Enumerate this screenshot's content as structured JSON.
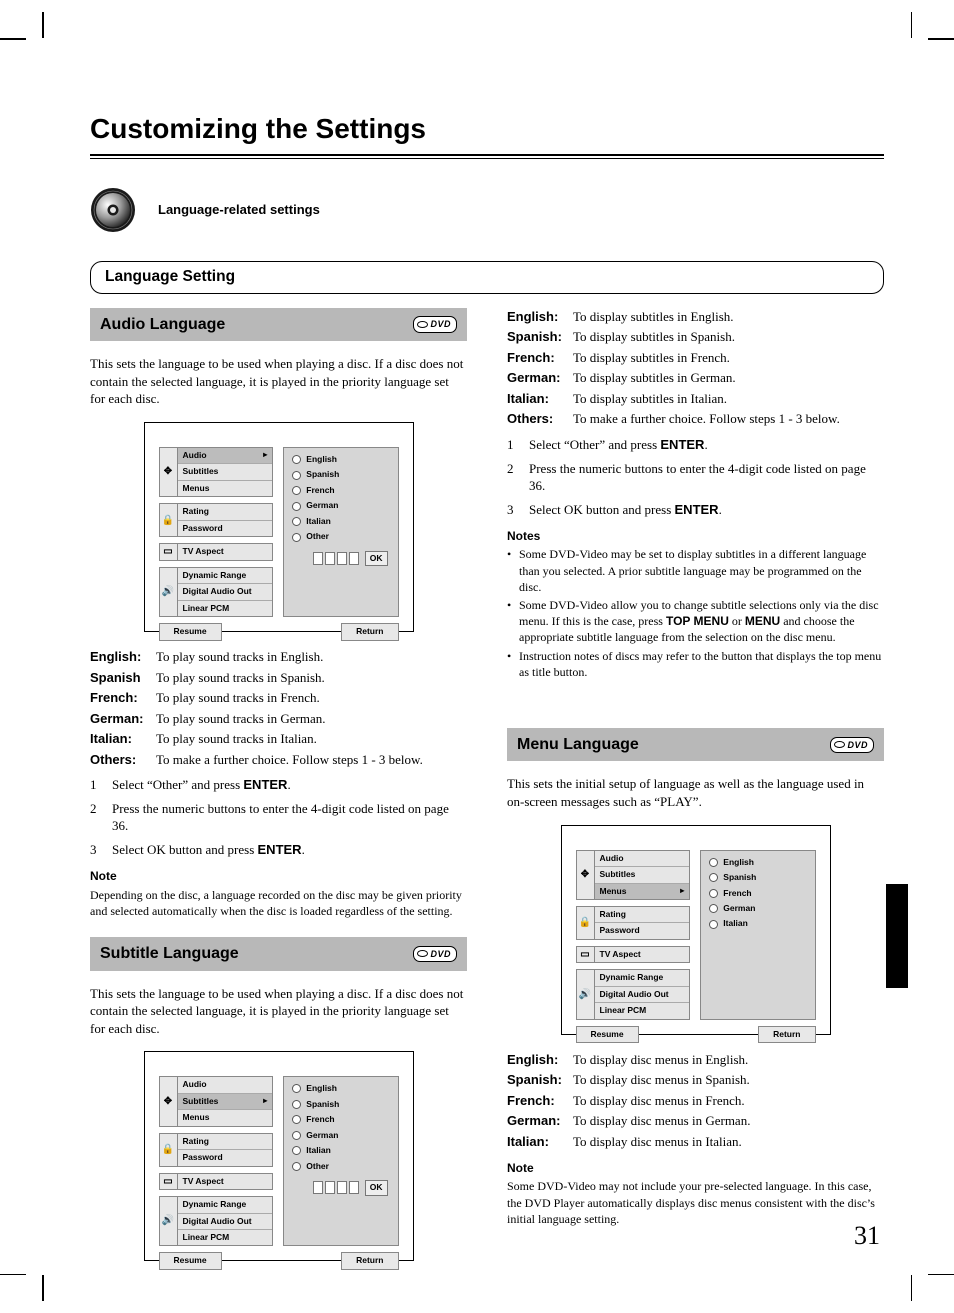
{
  "page": {
    "title": "Customizing the Settings",
    "intro_label": "Language-related settings",
    "section_head": "Language Setting",
    "number": "31"
  },
  "dvd_label": "DVD",
  "osd": {
    "left_groups": [
      {
        "icon": "✥",
        "items": [
          "Audio",
          "Subtitles",
          "Menus"
        ]
      },
      {
        "icon": "🔒",
        "items": [
          "Rating",
          "Password"
        ]
      },
      {
        "icon": "▭",
        "items": [
          "TV Aspect"
        ]
      },
      {
        "icon": "🔊",
        "items": [
          "Dynamic Range",
          "Digital Audio Out",
          "Linear PCM"
        ]
      }
    ],
    "langs6": [
      "English",
      "Spanish",
      "French",
      "German",
      "Italian",
      "Other"
    ],
    "langs5": [
      "English",
      "Spanish",
      "French",
      "German",
      "Italian"
    ],
    "ok": "OK",
    "resume": "Resume",
    "return": "Return"
  },
  "audio": {
    "head": "Audio Language",
    "intro": "This sets the language to be used when playing a disc. If a disc does not contain the selected language, it is played in the priority language set for each disc.",
    "sel_index": 0,
    "defs": [
      {
        "term": "English:",
        "desc": "To play sound tracks in English."
      },
      {
        "term": "Spanish",
        "desc": "To play sound tracks in Spanish."
      },
      {
        "term": "French:",
        "desc": "To play sound tracks in French."
      },
      {
        "term": "German:",
        "desc": "To play sound tracks in German."
      },
      {
        "term": "Italian:",
        "desc": "To play sound tracks in Italian."
      },
      {
        "term": "Others:",
        "desc": "To make a further choice. Follow steps 1 - 3 below."
      }
    ],
    "steps": [
      {
        "n": "1",
        "pre": "Select “Other” and press ",
        "bold": "ENTER",
        "post": "."
      },
      {
        "n": "2",
        "pre": "Press the numeric buttons to enter the 4-digit code listed on page 36.",
        "bold": "",
        "post": ""
      },
      {
        "n": "3",
        "pre": "Select OK button and press ",
        "bold": "ENTER",
        "post": "."
      }
    ],
    "note_head": "Note",
    "note_body": "Depending on the disc, a language recorded on the disc may be given priority and selected automatically when the disc is loaded regardless of the setting."
  },
  "subtitle": {
    "head": "Subtitle Language",
    "intro": "This sets the language to be used when playing a disc. If a disc does not contain the selected language, it is played in the priority language set for each disc.",
    "sel_index": 1,
    "defs": [
      {
        "term": "English:",
        "desc": "To display subtitles in English."
      },
      {
        "term": "Spanish:",
        "desc": "To display subtitles in Spanish."
      },
      {
        "term": "French:",
        "desc": "To display subtitles in French."
      },
      {
        "term": "German:",
        "desc": "To display subtitles in German."
      },
      {
        "term": "Italian:",
        "desc": "To display subtitles in Italian."
      },
      {
        "term": "Others:",
        "desc": "To make a further choice. Follow steps 1 - 3 below."
      }
    ],
    "steps": [
      {
        "n": "1",
        "pre": "Select “Other” and press ",
        "bold": "ENTER",
        "post": "."
      },
      {
        "n": "2",
        "pre": "Press the numeric buttons to enter the 4-digit code listed on page 36.",
        "bold": "",
        "post": ""
      },
      {
        "n": "3",
        "pre": "Select OK button and press ",
        "bold": "ENTER",
        "post": "."
      }
    ],
    "note_head": "Notes",
    "bullets": [
      "Some DVD-Video may be set to display subtitles in a different language than you selected. A prior subtitle language may be programmed on the disc.",
      "Some DVD-Video allow you to change subtitle selections only via the disc menu. If this is the case, press TOP MENU or MENU and choose the appropriate subtitle language from the selection on the disc menu.",
      "Instruction notes of discs may refer to the button that displays the top menu as title button."
    ]
  },
  "menu": {
    "head": "Menu Language",
    "intro": "This sets the initial setup of language as well as the language used in on-screen messages such as “PLAY”.",
    "sel_index": 2,
    "defs": [
      {
        "term": "English:",
        "desc": "To display disc menus in English."
      },
      {
        "term": "Spanish:",
        "desc": "To display disc menus in Spanish."
      },
      {
        "term": "French:",
        "desc": "To display disc menus in French."
      },
      {
        "term": "German:",
        "desc": "To display disc menus in German."
      },
      {
        "term": "Italian:",
        "desc": "To display disc menus in Italian."
      }
    ],
    "note_head": "Note",
    "note_body": "Some DVD-Video may not include your pre-selected language. In this case, the DVD Player automatically displays disc menus consistent with the disc’s initial language setting."
  }
}
